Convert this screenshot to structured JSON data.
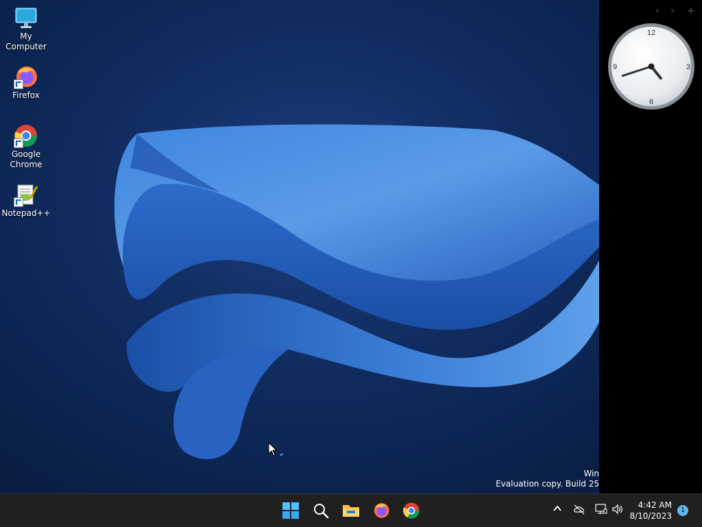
{
  "desktop_icons": [
    {
      "label": "My Computer",
      "icon": "monitor-icon"
    },
    {
      "label": "Firefox",
      "icon": "firefox-icon"
    },
    {
      "label": "Google Chrome",
      "icon": "chrome-icon"
    },
    {
      "label": "Notepad++",
      "icon": "notepadpp-icon"
    }
  ],
  "sidebar": {
    "nav_prev": "‹",
    "nav_next": "›",
    "nav_add": "+",
    "clock": {
      "numeral_12": "12",
      "numeral_3": "3",
      "numeral_6": "6",
      "numeral_9": "9",
      "hour": 4,
      "minute": 42
    }
  },
  "watermark": {
    "line1": "Win",
    "line2": "Evaluation copy. Build 25"
  },
  "taskbar": {
    "pinned": [
      "start-icon",
      "search-icon",
      "file-explorer-icon",
      "firefox-icon",
      "chrome-icon"
    ],
    "tray": [
      "chevron-up-icon",
      "onedrive-icon",
      "network-icon",
      "volume-icon"
    ],
    "time": "4:42 AM",
    "date": "8/10/2023",
    "notification_count": "1"
  },
  "colors": {
    "accent": "#3b7fd8",
    "taskbar": "#202020",
    "sidebar": "#000000"
  }
}
